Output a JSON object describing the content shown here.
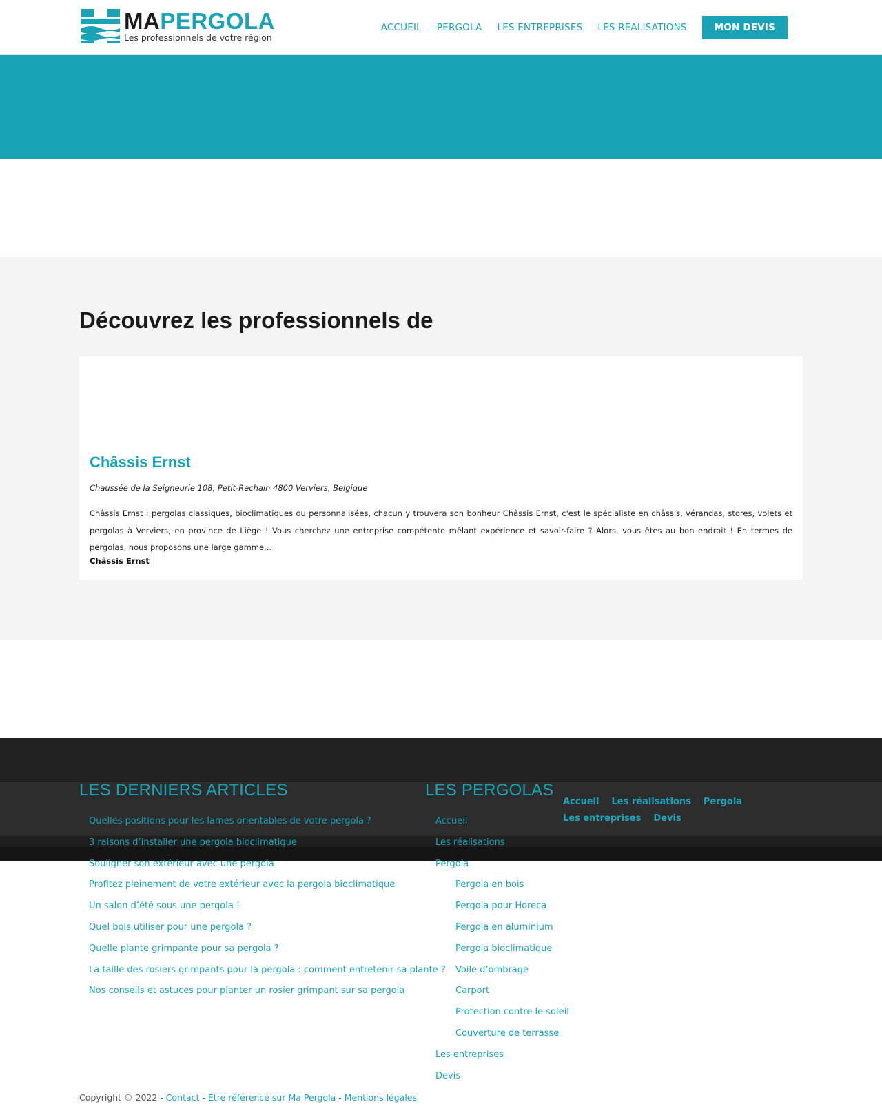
{
  "brand": {
    "title_ma": "MA",
    "title_pergola": "PERGOLA",
    "tagline": "Les professionnels de votre région",
    "accent_color": "#1aa3b7"
  },
  "nav": {
    "items": [
      "ACCUEIL",
      "PERGOLA",
      "LES ENTREPRISES",
      "LES RÉALISATIONS"
    ],
    "cta": "MON DEVIS"
  },
  "main": {
    "title": "Découvrez les professionnels de",
    "company": {
      "name": "Châssis Ernst",
      "address": "Chaussée de la Seigneurie 108, Petit-Rechain 4800 Verviers, Belgique",
      "description": "Châssis Ernst : pergolas classiques, bioclimatiques ou personnalisées, chacun y trouvera son bonheur Châssis Ernst, c'est le spécialiste en châssis, vérandas, stores, volets et pergolas à Verviers, en province de Liège ! Vous cherchez une entreprise compétente mêlant expérience et savoir-faire ? Alors, vous êtes au bon endroit ! En termes de pergolas, nous proposons une large gamme...",
      "footer_name": "Châssis Ernst"
    }
  },
  "footer": {
    "articles_title": "LES DERNIERS ARTICLES",
    "articles": [
      "Quelles positions pour les lames orientables de votre pergola ?",
      "3 raisons d’installer une pergola bioclimatique",
      "Souligner son extérieur avec une pergola",
      "Profitez pleinement de votre extérieur avec la pergola bioclimatique",
      "Un salon d’été sous une pergola !",
      "Quel bois utiliser pour une pergola ?",
      "Quelle plante grimpante pour sa pergola ?",
      "La taille des rosiers grimpants pour la pergola : comment entretenir sa plante ?",
      "Nos conseils et astuces pour planter un rosier grimpant sur sa pergola"
    ],
    "pergolas_title": "LES PERGOLAS",
    "pergolas": [
      {
        "label": "Accueil",
        "sub": false
      },
      {
        "label": "Les réalisations",
        "sub": false
      },
      {
        "label": "Pergola",
        "sub": false
      },
      {
        "label": "Pergola en bois",
        "sub": true
      },
      {
        "label": "Pergola pour Horeca",
        "sub": true
      },
      {
        "label": "Pergola en aluminium",
        "sub": true
      },
      {
        "label": "Pergola bioclimatique",
        "sub": true
      },
      {
        "label": "Voile d’ombrage",
        "sub": true
      },
      {
        "label": "Carport",
        "sub": true
      },
      {
        "label": "Protection contre le soleil",
        "sub": true
      },
      {
        "label": "Couverture de terrasse",
        "sub": true
      },
      {
        "label": "Les entreprises",
        "sub": false
      },
      {
        "label": "Devis",
        "sub": false
      }
    ],
    "inline_links": [
      "Accueil",
      "Les réalisations",
      "Pergola",
      "Les entreprises",
      "Devis"
    ],
    "copyright": {
      "text": "Copyright © 2022 - ",
      "links": [
        "Contact",
        "Etre référencé sur Ma Pergola",
        "Mentions légales"
      ],
      "separator": " - "
    }
  }
}
